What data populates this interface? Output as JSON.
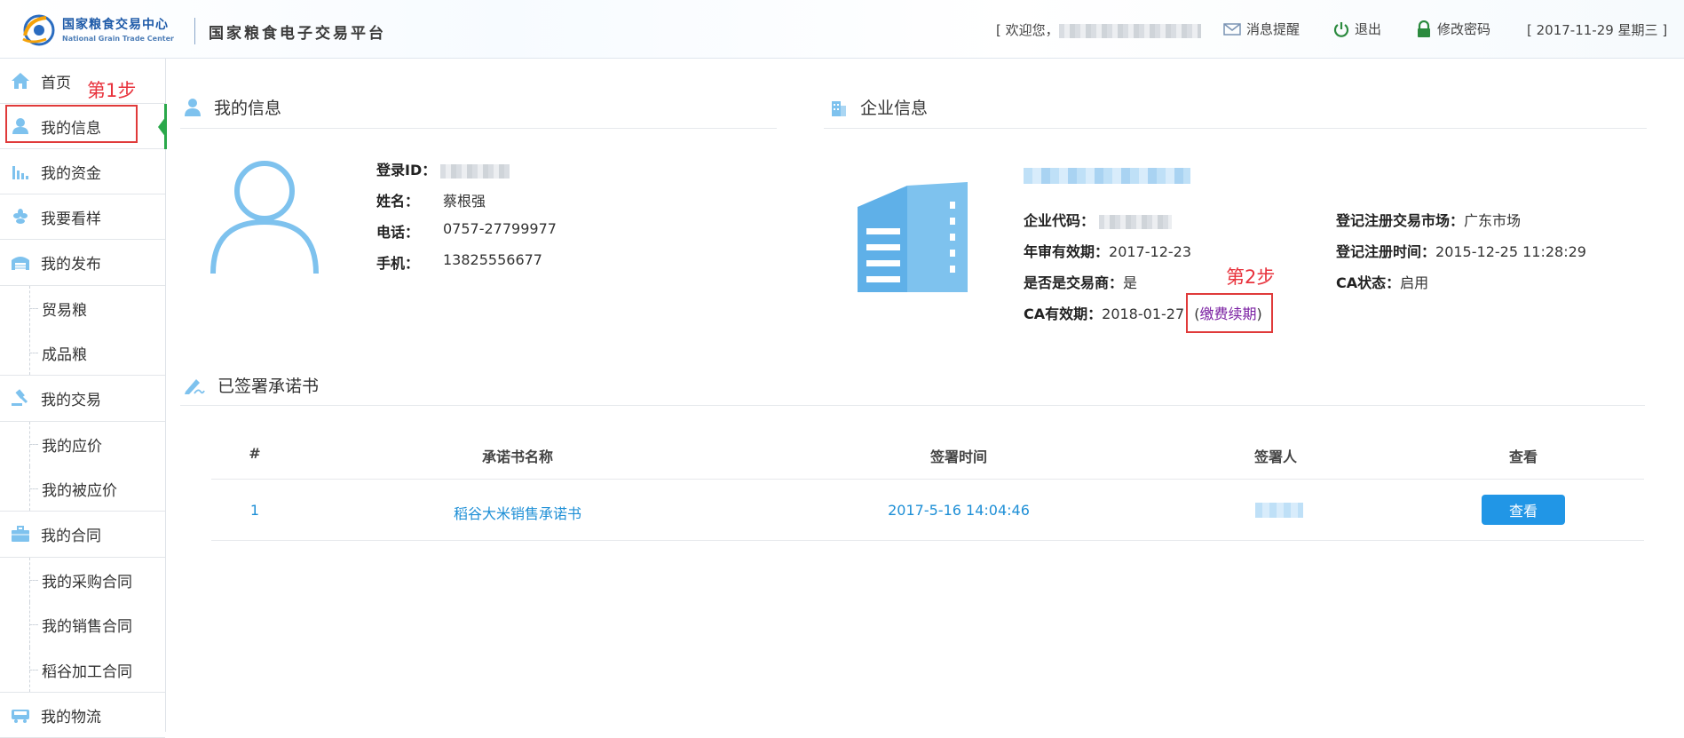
{
  "header": {
    "logo_cn": "国家粮食交易中心",
    "logo_en": "National Grain Trade Center",
    "platform_title": "国家粮食电子交易平台",
    "welcome_label": "[ 欢迎您，",
    "welcome_suffix": "]",
    "message_label": "消息提醒",
    "logout_label": "退出",
    "password_label": "修改密码",
    "date_label": "[ 2017-11-29 星期三 ]"
  },
  "sidebar": {
    "items": [
      {
        "label": "首页",
        "icon": "home-icon"
      },
      {
        "label": "我的信息",
        "icon": "user-icon"
      },
      {
        "label": "我的资金",
        "icon": "bar-chart-icon"
      },
      {
        "label": "我要看样",
        "icon": "wheat-icon"
      },
      {
        "label": "我的发布",
        "icon": "warehouse-icon"
      },
      {
        "label": "贸易粮"
      },
      {
        "label": "成品粮"
      },
      {
        "label": "我的交易",
        "icon": "gavel-icon"
      },
      {
        "label": "我的应价"
      },
      {
        "label": "我的被应价"
      },
      {
        "label": "我的合同",
        "icon": "briefcase-icon"
      },
      {
        "label": "我的采购合同"
      },
      {
        "label": "我的销售合同"
      },
      {
        "label": "稻谷加工合同"
      },
      {
        "label": "我的物流",
        "icon": "truck-icon"
      }
    ]
  },
  "annotations": {
    "step1": "第1步",
    "step2": "第2步"
  },
  "my_info": {
    "title": "我的信息",
    "login_id_label": "登录ID：",
    "name_label": "姓名：",
    "name_value": "蔡根强",
    "phone_label": "电话：",
    "phone_value": "0757-27799977",
    "mobile_label": "手机：",
    "mobile_value": "13825556677"
  },
  "company_info": {
    "title": "企业信息",
    "code_label": "企业代码：",
    "annual_label": "年审有效期：",
    "annual_value": "2017-12-23",
    "is_trader_label": "是否是交易商：",
    "is_trader_value": "是",
    "ca_label": "CA有效期：",
    "ca_value": "2018-01-27",
    "renew_open": "(",
    "renew_link": "缴费续期",
    "renew_close": ")",
    "market_label": "登记注册交易市场：",
    "market_value": "广东市场",
    "reg_time_label": "登记注册时间：",
    "reg_time_value": "2015-12-25 11:28:29",
    "ca_status_label": "CA状态：",
    "ca_status_value": "启用"
  },
  "pledges": {
    "title": "已签署承诺书",
    "columns": [
      "#",
      "承诺书名称",
      "签署时间",
      "签署人",
      "查看"
    ],
    "rows": [
      {
        "index": "1",
        "name": "稻谷大米销售承诺书",
        "time": "2017-5-16 14:04:46",
        "action": "查看"
      }
    ]
  },
  "colors": {
    "accent": "#2196e6",
    "link_blue": "#1e8fd6",
    "active_green": "#2aa84a",
    "annotation_red": "#e03a3a",
    "icon_blue": "#7ec2ee"
  }
}
